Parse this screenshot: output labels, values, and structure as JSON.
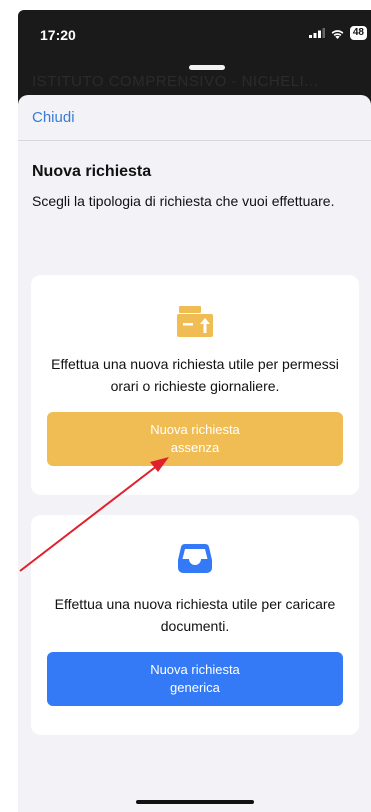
{
  "status_bar": {
    "time": "17:20",
    "battery": "48"
  },
  "background_title": "ISTITUTO COMPRENSIVO - NICHELI...",
  "sheet": {
    "close_label": "Chiudi",
    "title": "Nuova richiesta",
    "subtitle": "Scegli la tipologia di richiesta che vuoi effettuare."
  },
  "cards": [
    {
      "icon": "boxes-upload-icon",
      "description": "Effettua una nuova richiesta utile per permessi orari o richieste giornaliere.",
      "button_line1": "Nuova richiesta",
      "button_line2": "assenza",
      "color": "#f0bd54"
    },
    {
      "icon": "inbox-tray-icon",
      "description": "Effettua una nuova richiesta utile per caricare documenti.",
      "button_line1": "Nuova richiesta",
      "button_line2": "generica",
      "color": "#3479f6"
    }
  ],
  "annotation": {
    "arrow_color": "#e0202c"
  }
}
